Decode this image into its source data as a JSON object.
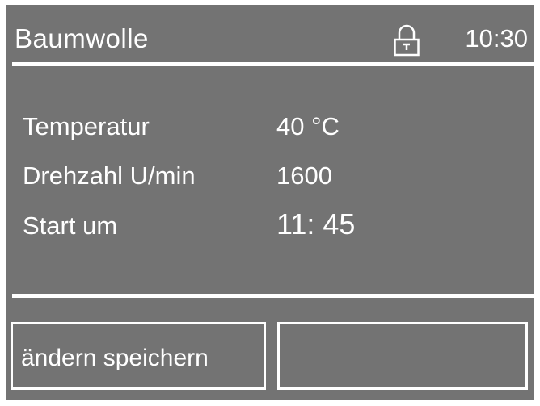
{
  "header": {
    "title": "Baumwolle",
    "lock_icon": "lock-icon",
    "time": "10:30"
  },
  "settings": [
    {
      "label": "Temperatur",
      "value": "40 °C"
    },
    {
      "label": "Drehzahl U/min",
      "value": "1600"
    },
    {
      "label": "Start um",
      "value": "11: 45"
    }
  ],
  "softkeys": {
    "left_label": "ändern speichern",
    "right_label": ""
  },
  "colors": {
    "screen_background": "#737373",
    "foreground": "#ffffff"
  }
}
